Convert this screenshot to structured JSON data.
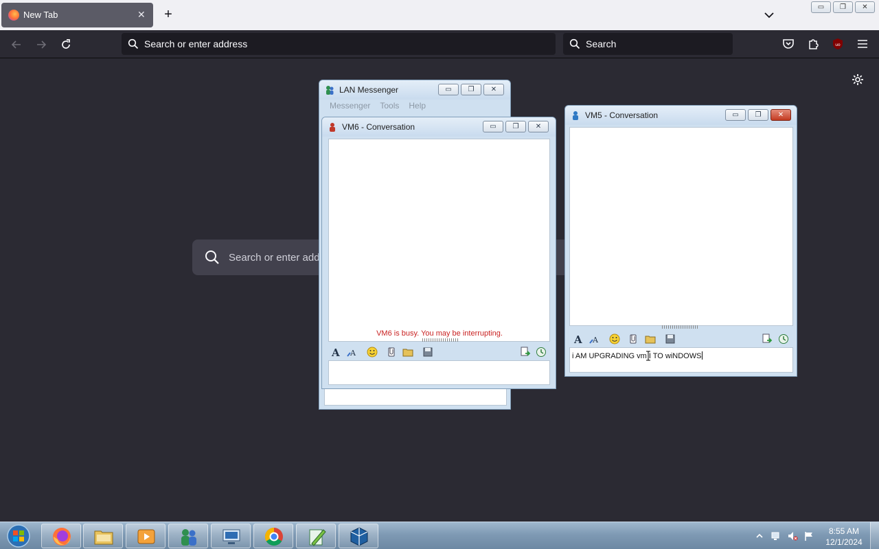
{
  "browser": {
    "tab_title": "New Tab",
    "tab_close": "✕",
    "new_tab": "+",
    "url_placeholder": "Search or enter address",
    "search_placeholder": "Search",
    "newtab_search_placeholder": "Search or enter address"
  },
  "lan_messenger": {
    "title": "LAN Messenger",
    "menu": [
      "Messenger",
      "Tools",
      "Help"
    ]
  },
  "vm6_window": {
    "title": "VM6 - Conversation",
    "status": "VM6 is busy. You may be interrupting.",
    "input_value": ""
  },
  "vm5_window": {
    "title": "VM5 - Conversation",
    "input_value": "i AM UPGRADING vm I TO wiNDOWS"
  },
  "window_buttons": {
    "minimize": "▭",
    "restore": "❐",
    "close": "✕"
  },
  "taskbar": {
    "apps": [
      "firefox",
      "file-explorer",
      "media-player",
      "lan-messenger",
      "remote-desktop",
      "chrome",
      "notepad-plus",
      "virtualbox"
    ],
    "clock_time": "8:55 AM",
    "clock_date": "12/1/2024"
  },
  "colors": {
    "firefox_bg": "#2b2a33",
    "busy_text": "#c81f1f",
    "taskbar": "#7f9ab4"
  }
}
